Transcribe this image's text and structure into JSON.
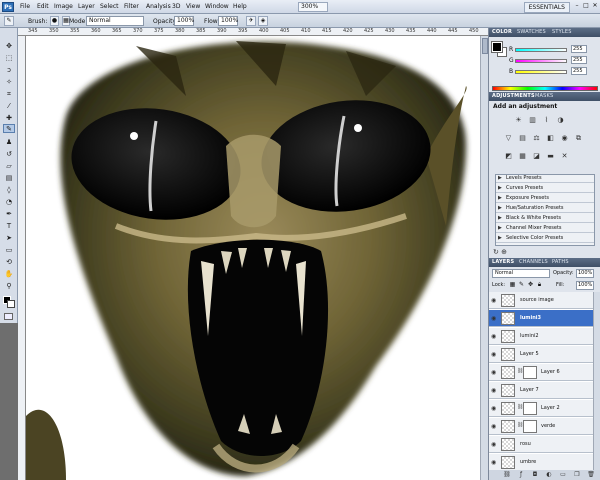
{
  "app": {
    "logo": "Ps",
    "menu": [
      "File",
      "Edit",
      "Image",
      "Layer",
      "Select",
      "Filter",
      "Analysis",
      "3D",
      "View",
      "Window",
      "Help"
    ],
    "zoom": "300%",
    "workspace": "ESSENTIALS",
    "window_buttons": [
      "–",
      "□",
      "✕"
    ]
  },
  "options": {
    "brush_label": "Brush:",
    "mode_label": "Mode:",
    "mode_value": "Normal",
    "opacity_label": "Opacity:",
    "opacity_value": "100%",
    "flow_label": "Flow:",
    "flow_value": "100%"
  },
  "rulers": {
    "top_ticks": [
      "345",
      "350",
      "355",
      "360",
      "365",
      "370",
      "375",
      "380",
      "385",
      "390",
      "395",
      "400",
      "405",
      "410",
      "415",
      "420",
      "425",
      "430",
      "435",
      "440",
      "445",
      "450"
    ]
  },
  "panels": {
    "color_tabs": [
      "COLOR",
      "SWATCHES",
      "STYLES"
    ],
    "color_sliders": [
      {
        "label": "R",
        "value": "255"
      },
      {
        "label": "G",
        "value": "255"
      },
      {
        "label": "B",
        "value": "255"
      }
    ],
    "adj_tabs": [
      "ADJUSTMENTS",
      "MASKS"
    ],
    "adj_title": "Add an adjustment",
    "adj_presets": [
      "Levels Presets",
      "Curves Presets",
      "Exposure Presets",
      "Hue/Saturation Presets",
      "Black & White Presets",
      "Channel Mixer Presets",
      "Selective Color Presets"
    ],
    "layer_tabs": [
      "LAYERS",
      "CHANNELS",
      "PATHS"
    ],
    "blend_mode": "Normal",
    "opacity_label": "Opacity:",
    "opacity_value": "100%",
    "lock_label": "Lock:",
    "fill_label": "Fill:",
    "fill_value": "100%"
  },
  "layers": [
    {
      "name": "source image",
      "selected": false,
      "mask": false
    },
    {
      "name": "lumini3",
      "selected": true,
      "mask": false
    },
    {
      "name": "lumini2",
      "selected": false,
      "mask": false
    },
    {
      "name": "Layer 5",
      "selected": false,
      "mask": false
    },
    {
      "name": "Layer 6",
      "selected": false,
      "mask": true
    },
    {
      "name": "Layer 7",
      "selected": false,
      "mask": false
    },
    {
      "name": "Layer 2",
      "selected": false,
      "mask": true
    },
    {
      "name": "verde",
      "selected": false,
      "mask": true
    },
    {
      "name": "rosu",
      "selected": false,
      "mask": false
    },
    {
      "name": "umbre",
      "selected": false,
      "mask": false
    }
  ],
  "colors": {
    "accent": "#3b6fc7",
    "panel_bg": "#dfe4ec",
    "dock_header": "#4a5a72"
  }
}
